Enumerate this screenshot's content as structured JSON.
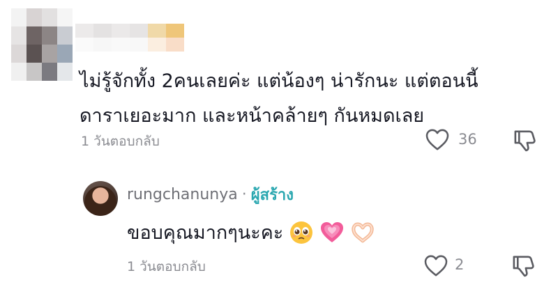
{
  "comment": {
    "text_line1": "ไม่รู้จักทั้ง 2คนเลยค่ะ แต่น้องๆ น่ารักนะ แต่ตอนนี้",
    "text_line2": "ดาราเยอะมาก และหน้าคล้ายๆ กันหมดเลย",
    "time": "1 วัน",
    "reply_label": "ตอบกลับ",
    "like_count": "36"
  },
  "reply": {
    "username": "rungchanunya",
    "separator": "·",
    "creator_label": "ผู้สร้าง",
    "text": "ขอบคุณมากๆนะคะ",
    "emojis": [
      "pleading-face-emoji",
      "growing-heart-emoji",
      "heart-hands-emoji"
    ],
    "time": "1 วัน",
    "reply_label": "ตอบกลับ",
    "like_count": "2"
  },
  "colors": {
    "text": "#161823",
    "meta": "#8a8b91",
    "creator": "#2aa7b0"
  },
  "icons": [
    "heart-outline-icon",
    "dislike-icon"
  ]
}
